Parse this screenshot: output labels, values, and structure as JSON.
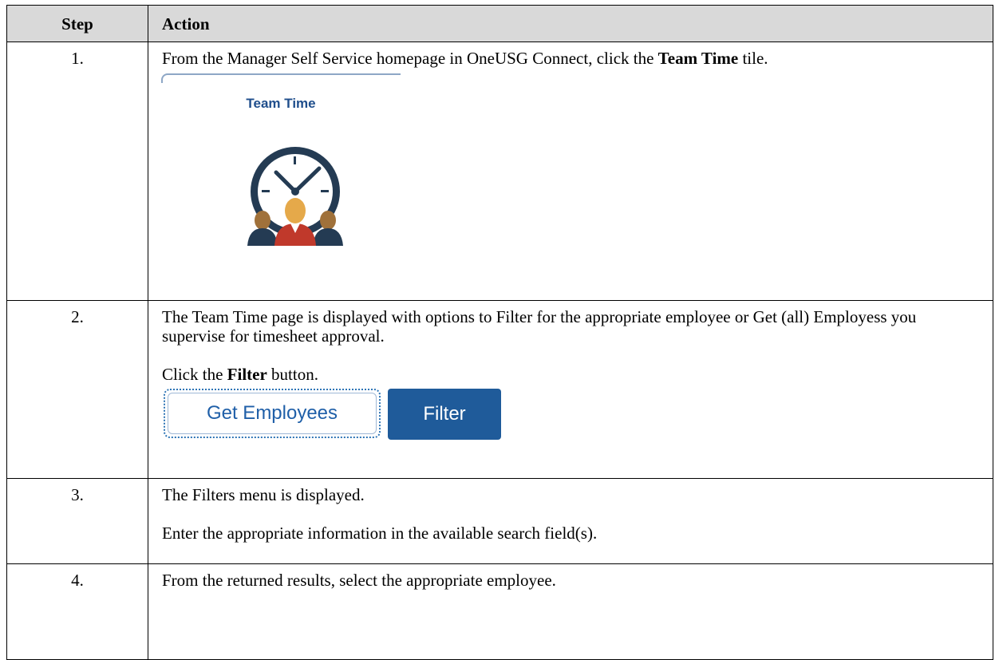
{
  "table": {
    "headers": {
      "step": "Step",
      "action": "Action"
    },
    "rows": [
      {
        "step": "1.",
        "text_before": "From the Manager Self Service homepage in OneUSG Connect, click the ",
        "bold": "Team Time",
        "text_after": " tile."
      },
      {
        "step": "2.",
        "line1": "The Team Time page is displayed with options to Filter for the appropriate employee or Get (all) Employess you supervise for timesheet approval.",
        "click_before": "Click the ",
        "click_bold": "Filter",
        "click_after": " button."
      },
      {
        "step": "3.",
        "line1": "The Filters menu is displayed.",
        "line2": "Enter the appropriate information in the available search field(s)."
      },
      {
        "step": "4.",
        "line1": "From the returned results, select the appropriate employee."
      }
    ]
  },
  "tile": {
    "title": "Team Time",
    "icon": "clock-team-icon"
  },
  "buttons": {
    "get_employees": "Get Employees",
    "filter": "Filter"
  },
  "colors": {
    "header_bg": "#d9d9d9",
    "tile_title": "#1f4e8c",
    "filter_bg": "#1f5b9a",
    "link_blue": "#1f5fa8"
  }
}
